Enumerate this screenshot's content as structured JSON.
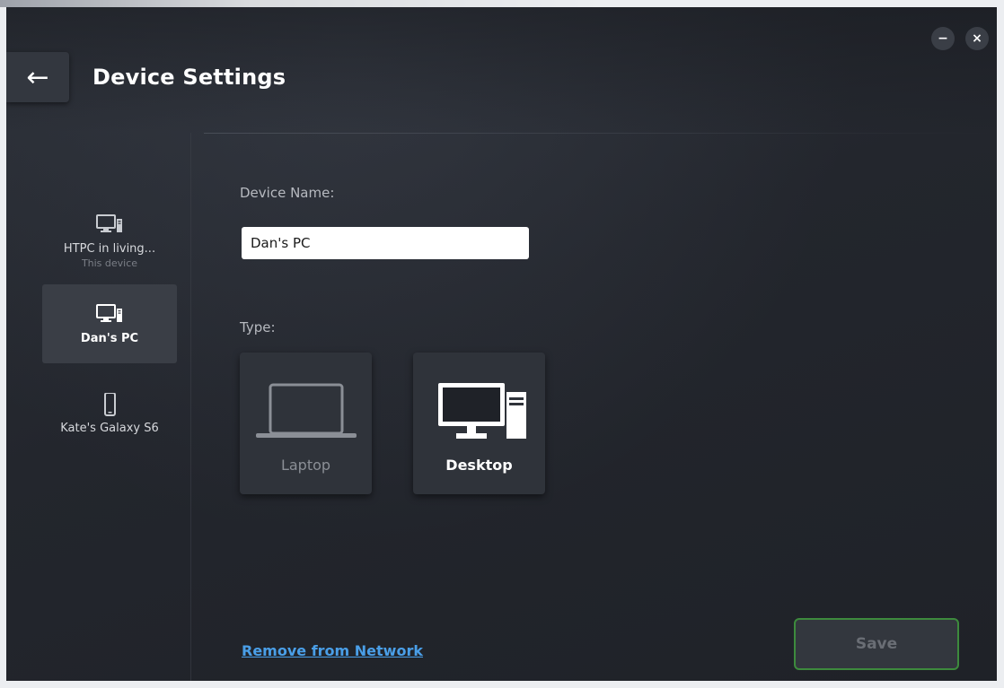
{
  "header": {
    "title": "Device Settings",
    "back_icon": "←",
    "minimize_icon": "−",
    "close_icon": "×"
  },
  "sidebar": {
    "devices": [
      {
        "label": "HTPC in living...",
        "sublabel": "This device",
        "icon": "desktop-icon",
        "selected": false
      },
      {
        "label": "Dan's PC",
        "sublabel": "",
        "icon": "desktop-icon",
        "selected": true
      },
      {
        "label": "Kate's Galaxy S6",
        "sublabel": "",
        "icon": "phone-icon",
        "selected": false
      }
    ]
  },
  "main": {
    "device_name_label": "Device Name:",
    "device_name_value": "Dan's PC",
    "type_label": "Type:",
    "types": [
      {
        "label": "Laptop",
        "icon": "laptop-icon",
        "selected": false
      },
      {
        "label": "Desktop",
        "icon": "desktop-icon",
        "selected": true
      }
    ],
    "remove_link": "Remove from Network",
    "save_label": "Save"
  },
  "colors": {
    "accent_green": "#3d8a3d",
    "link_blue": "#4a9fe8",
    "background": "#24272e"
  }
}
